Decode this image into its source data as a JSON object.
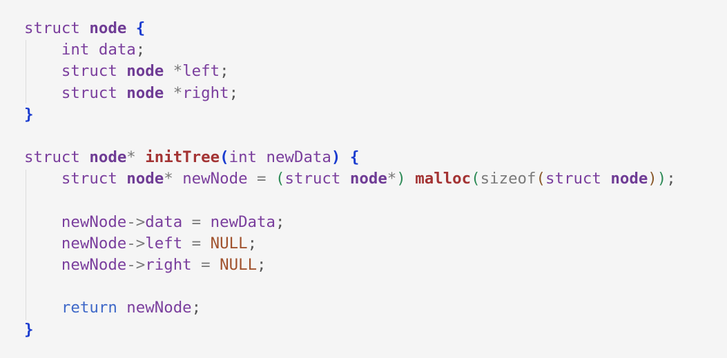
{
  "editor": {
    "language": "c",
    "colors": {
      "background": "#f5f5f5",
      "keyword": "#7a3e9d",
      "type": "#6f3c95",
      "function": "#a33333",
      "brace": "#1a3ccf",
      "null": "#a0522d",
      "return": "#3e68c8"
    },
    "lines": [
      [
        {
          "t": "struct",
          "c": "kw"
        },
        {
          "t": " ",
          "c": ""
        },
        {
          "t": "node",
          "c": "ty"
        },
        {
          "t": " ",
          "c": ""
        },
        {
          "t": "{",
          "c": "br1"
        }
      ],
      [
        {
          "t": "    ",
          "c": ""
        },
        {
          "t": "int",
          "c": "kw"
        },
        {
          "t": " ",
          "c": ""
        },
        {
          "t": "data",
          "c": "id"
        },
        {
          "t": ";",
          "c": "pun"
        }
      ],
      [
        {
          "t": "    ",
          "c": ""
        },
        {
          "t": "struct",
          "c": "kw"
        },
        {
          "t": " ",
          "c": ""
        },
        {
          "t": "node",
          "c": "ty"
        },
        {
          "t": " ",
          "c": ""
        },
        {
          "t": "*",
          "c": "op"
        },
        {
          "t": "left",
          "c": "id"
        },
        {
          "t": ";",
          "c": "pun"
        }
      ],
      [
        {
          "t": "    ",
          "c": ""
        },
        {
          "t": "struct",
          "c": "kw"
        },
        {
          "t": " ",
          "c": ""
        },
        {
          "t": "node",
          "c": "ty"
        },
        {
          "t": " ",
          "c": ""
        },
        {
          "t": "*",
          "c": "op"
        },
        {
          "t": "right",
          "c": "id"
        },
        {
          "t": ";",
          "c": "pun"
        }
      ],
      [
        {
          "t": "}",
          "c": "br1"
        }
      ],
      [],
      [
        {
          "t": "struct",
          "c": "kw"
        },
        {
          "t": " ",
          "c": ""
        },
        {
          "t": "node",
          "c": "ty"
        },
        {
          "t": "*",
          "c": "op"
        },
        {
          "t": " ",
          "c": ""
        },
        {
          "t": "initTree",
          "c": "fn"
        },
        {
          "t": "(",
          "c": "br1"
        },
        {
          "t": "int",
          "c": "kw"
        },
        {
          "t": " ",
          "c": ""
        },
        {
          "t": "newData",
          "c": "id"
        },
        {
          "t": ")",
          "c": "br1"
        },
        {
          "t": " ",
          "c": ""
        },
        {
          "t": "{",
          "c": "br1"
        }
      ],
      [
        {
          "t": "    ",
          "c": ""
        },
        {
          "t": "struct",
          "c": "kw"
        },
        {
          "t": " ",
          "c": ""
        },
        {
          "t": "node",
          "c": "ty"
        },
        {
          "t": "*",
          "c": "op"
        },
        {
          "t": " ",
          "c": ""
        },
        {
          "t": "newNode",
          "c": "id"
        },
        {
          "t": " = ",
          "c": "op"
        },
        {
          "t": "(",
          "c": "br2"
        },
        {
          "t": "struct",
          "c": "kw"
        },
        {
          "t": " ",
          "c": ""
        },
        {
          "t": "node",
          "c": "ty"
        },
        {
          "t": "*",
          "c": "op"
        },
        {
          "t": ")",
          "c": "br2"
        },
        {
          "t": " ",
          "c": ""
        },
        {
          "t": "malloc",
          "c": "fn"
        },
        {
          "t": "(",
          "c": "br2"
        },
        {
          "t": "sizeof",
          "c": "op"
        },
        {
          "t": "(",
          "c": "br3"
        },
        {
          "t": "struct",
          "c": "kw"
        },
        {
          "t": " ",
          "c": ""
        },
        {
          "t": "node",
          "c": "ty"
        },
        {
          "t": ")",
          "c": "br3"
        },
        {
          "t": ")",
          "c": "br2"
        },
        {
          "t": ";",
          "c": "pun"
        }
      ],
      [],
      [
        {
          "t": "    ",
          "c": ""
        },
        {
          "t": "newNode",
          "c": "id"
        },
        {
          "t": "->",
          "c": "op"
        },
        {
          "t": "data",
          "c": "id"
        },
        {
          "t": " = ",
          "c": "op"
        },
        {
          "t": "newData",
          "c": "id"
        },
        {
          "t": ";",
          "c": "pun"
        }
      ],
      [
        {
          "t": "    ",
          "c": ""
        },
        {
          "t": "newNode",
          "c": "id"
        },
        {
          "t": "->",
          "c": "op"
        },
        {
          "t": "left",
          "c": "id"
        },
        {
          "t": " = ",
          "c": "op"
        },
        {
          "t": "NULL",
          "c": "nul"
        },
        {
          "t": ";",
          "c": "pun"
        }
      ],
      [
        {
          "t": "    ",
          "c": ""
        },
        {
          "t": "newNode",
          "c": "id"
        },
        {
          "t": "->",
          "c": "op"
        },
        {
          "t": "right",
          "c": "id"
        },
        {
          "t": " = ",
          "c": "op"
        },
        {
          "t": "NULL",
          "c": "nul"
        },
        {
          "t": ";",
          "c": "pun"
        }
      ],
      [],
      [
        {
          "t": "    ",
          "c": ""
        },
        {
          "t": "return",
          "c": "ret"
        },
        {
          "t": " ",
          "c": ""
        },
        {
          "t": "newNode",
          "c": "id"
        },
        {
          "t": ";",
          "c": "pun"
        }
      ],
      [
        {
          "t": "}",
          "c": "br1"
        }
      ]
    ]
  }
}
